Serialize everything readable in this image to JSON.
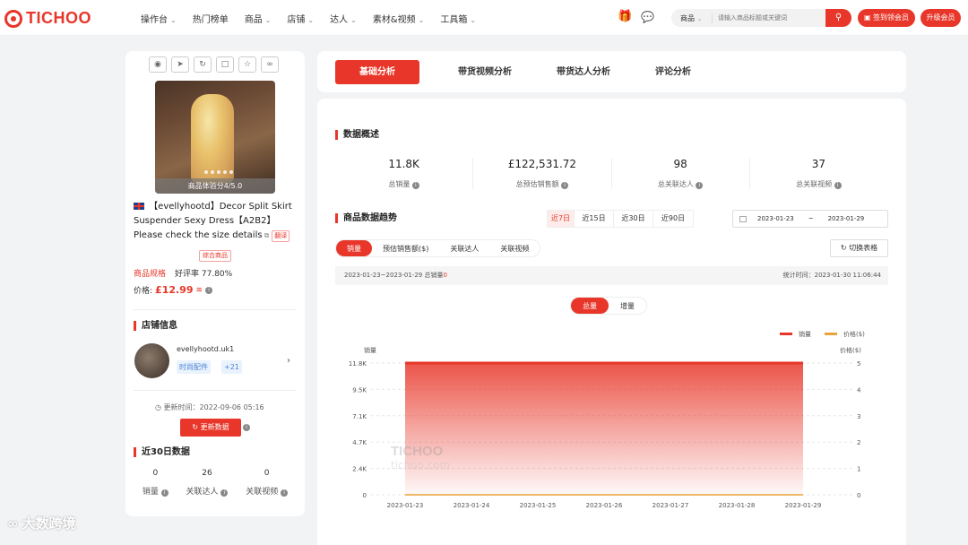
{
  "nav": {
    "logo": "TICHOO",
    "items": [
      {
        "label": "操作台",
        "chevron": true
      },
      {
        "label": "热门榜单",
        "chevron": false
      },
      {
        "label": "商品",
        "chevron": true
      },
      {
        "label": "店铺",
        "chevron": true
      },
      {
        "label": "达人",
        "chevron": true
      },
      {
        "label": "素材&视频",
        "chevron": true
      },
      {
        "label": "工具箱",
        "chevron": true
      }
    ],
    "search_type": "商品",
    "search_placeholder": "请输入商品标题或关键词",
    "sign_btn": "签到领会员",
    "upgrade_btn": "升级会员"
  },
  "product": {
    "score": "商品体验分4/5.0",
    "title": "【evellyhootd】Decor Split Skirt Suspender Sexy Dress【A2B2】 Please check the size details",
    "translate": "翻译",
    "combo_tag": "综合商品",
    "spec_label": "商品规格",
    "rating": "好评率 77.80%",
    "price_label": "价格:",
    "price": "£12.99"
  },
  "shop": {
    "section": "店铺信息",
    "name": "evellyhootd.uk1",
    "tag": "时尚配件",
    "tag_more": "+21",
    "update_time": "更新时间：2022-09-06 05:16",
    "update_btn": "更新数据"
  },
  "last30": {
    "section": "近30日数据",
    "items": [
      {
        "num": "0",
        "label": "销量"
      },
      {
        "num": "26",
        "label": "关联达人"
      },
      {
        "num": "0",
        "label": "关联视频"
      }
    ]
  },
  "tabs": [
    "基础分析",
    "带货视频分析",
    "带货达人分析",
    "评论分析"
  ],
  "overview": {
    "section": "数据概述",
    "items": [
      {
        "num": "11.8K",
        "label": "总销量"
      },
      {
        "num": "£122,531.72",
        "label": "总预估销售额"
      },
      {
        "num": "98",
        "label": "总关联达人"
      },
      {
        "num": "37",
        "label": "总关联视频"
      }
    ]
  },
  "trend": {
    "section": "商品数据趋势",
    "ranges": [
      "近7日",
      "近15日",
      "近30日",
      "近90日"
    ],
    "date_start": "2023-01-23",
    "date_sep": "~",
    "date_end": "2023-01-29",
    "metrics": [
      "销量",
      "预估销售额($)",
      "关联达人",
      "关联视频"
    ],
    "switch_btn": "切换表格",
    "summary_prefix": "2023-01-23~2023-01-29 总销量",
    "summary_value": "0",
    "stat_time": "统计时间：2023-01-30 11:06:44",
    "toggle": [
      "总量",
      "增量"
    ]
  },
  "chart_data": {
    "type": "area",
    "x": [
      "2023-01-23",
      "2023-01-24",
      "2023-01-25",
      "2023-01-26",
      "2023-01-27",
      "2023-01-28",
      "2023-01-29"
    ],
    "series": [
      {
        "name": "销量",
        "values": [
          11800,
          11800,
          11800,
          11800,
          11800,
          11800,
          11800
        ],
        "color": "#e8372a"
      },
      {
        "name": "价格($)",
        "values": [
          0,
          0,
          0,
          0,
          0,
          0,
          0
        ],
        "color": "#e8a33a"
      }
    ],
    "ylabel_left": "销量",
    "ylabel_right": "价格($)",
    "yticks_left": [
      "0",
      "2.4K",
      "4.7K",
      "7.1K",
      "9.5K",
      "11.8K"
    ],
    "yticks_right": [
      "0",
      "1",
      "2",
      "3",
      "4",
      "5"
    ],
    "ylim_left": [
      0,
      11800
    ],
    "ylim_right": [
      0,
      5
    ],
    "legend": "top-right",
    "grid": true
  },
  "watermark": {
    "brand": "TICHOO",
    "site": "tichoo.com"
  },
  "corner": "大数跨境"
}
